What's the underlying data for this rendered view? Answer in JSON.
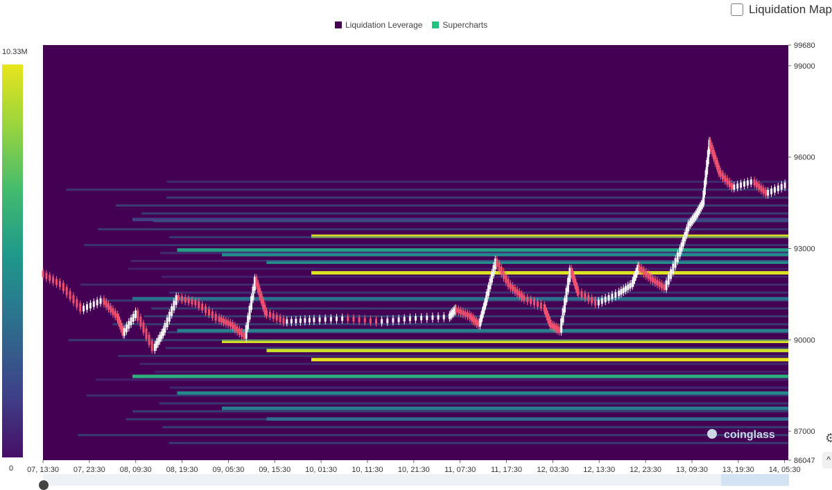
{
  "toggle": {
    "label": "Liquidation Map",
    "checked": false
  },
  "legend": [
    {
      "label": "Liquidation Leverage",
      "color": "#440154"
    },
    {
      "label": "Supercharts",
      "color": "#21c37e"
    }
  ],
  "colorbar": {
    "max_label": "10.33M",
    "min_label": "0"
  },
  "watermark": "coinglass",
  "chart_data": {
    "type": "heatmap",
    "overlay": "candlestick",
    "y_ticks": [
      "99680",
      "99000",
      "96000",
      "93000",
      "90000",
      "87000",
      "86047"
    ],
    "y_tick_values": [
      99680,
      99000,
      96000,
      93000,
      90000,
      87000,
      86047
    ],
    "ylim": [
      86047,
      99680
    ],
    "x_ticks": [
      "07, 13:30",
      "07, 23:30",
      "08, 09:30",
      "08, 19:30",
      "09, 05:30",
      "09, 15:30",
      "10, 01:30",
      "10, 11:30",
      "10, 21:30",
      "11, 07:30",
      "11, 17:30",
      "12, 03:30",
      "12, 13:30",
      "12, 23:30",
      "13, 09:30",
      "13, 19:30",
      "14, 05:30"
    ],
    "colorscale_range": [
      0,
      10330000
    ],
    "price_path": [
      [
        0,
        92200
      ],
      [
        0.03,
        91800
      ],
      [
        0.06,
        91000
      ],
      [
        0.09,
        91300
      ],
      [
        0.11,
        90800
      ],
      [
        0.12,
        90200
      ],
      [
        0.14,
        90900
      ],
      [
        0.165,
        89700
      ],
      [
        0.18,
        90300
      ],
      [
        0.2,
        91400
      ],
      [
        0.23,
        91200
      ],
      [
        0.26,
        90700
      ],
      [
        0.28,
        90500
      ],
      [
        0.3,
        90100
      ],
      [
        0.315,
        92000
      ],
      [
        0.33,
        90900
      ],
      [
        0.36,
        90600
      ],
      [
        0.4,
        90650
      ],
      [
        0.45,
        90700
      ],
      [
        0.5,
        90600
      ],
      [
        0.55,
        90700
      ],
      [
        0.6,
        90750
      ],
      [
        0.61,
        91000
      ],
      [
        0.63,
        90800
      ],
      [
        0.645,
        90500
      ],
      [
        0.655,
        91300
      ],
      [
        0.67,
        92600
      ],
      [
        0.69,
        91800
      ],
      [
        0.71,
        91400
      ],
      [
        0.74,
        91100
      ],
      [
        0.75,
        90500
      ],
      [
        0.765,
        90300
      ],
      [
        0.78,
        92300
      ],
      [
        0.79,
        91600
      ],
      [
        0.82,
        91200
      ],
      [
        0.85,
        91500
      ],
      [
        0.87,
        91800
      ],
      [
        0.88,
        92400
      ],
      [
        0.9,
        92000
      ],
      [
        0.92,
        91700
      ],
      [
        0.94,
        92800
      ],
      [
        0.955,
        93800
      ],
      [
        0.965,
        94100
      ],
      [
        0.975,
        94500
      ],
      [
        0.985,
        96500
      ],
      [
        1.0,
        95500
      ],
      [
        1.02,
        95000
      ],
      [
        1.05,
        95200
      ],
      [
        1.07,
        94800
      ],
      [
        1.1,
        95100
      ]
    ],
    "heat_bands": [
      {
        "price": 93950,
        "intensity": 0.15
      },
      {
        "price": 92950,
        "intensity": 0.62
      },
      {
        "price": 92800,
        "intensity": 0.52
      },
      {
        "price": 92550,
        "intensity": 0.55
      },
      {
        "price": 92200,
        "intensity": 0.98
      },
      {
        "price": 91350,
        "intensity": 0.36
      },
      {
        "price": 90300,
        "intensity": 0.46
      },
      {
        "price": 89950,
        "intensity": 0.97
      },
      {
        "price": 89650,
        "intensity": 0.95
      },
      {
        "price": 89350,
        "intensity": 0.99
      },
      {
        "price": 88800,
        "intensity": 0.68
      },
      {
        "price": 88250,
        "intensity": 0.48
      },
      {
        "price": 87750,
        "intensity": 0.42
      },
      {
        "price": 87400,
        "intensity": 0.32
      },
      {
        "price": 93400,
        "intensity": 0.99
      }
    ]
  }
}
